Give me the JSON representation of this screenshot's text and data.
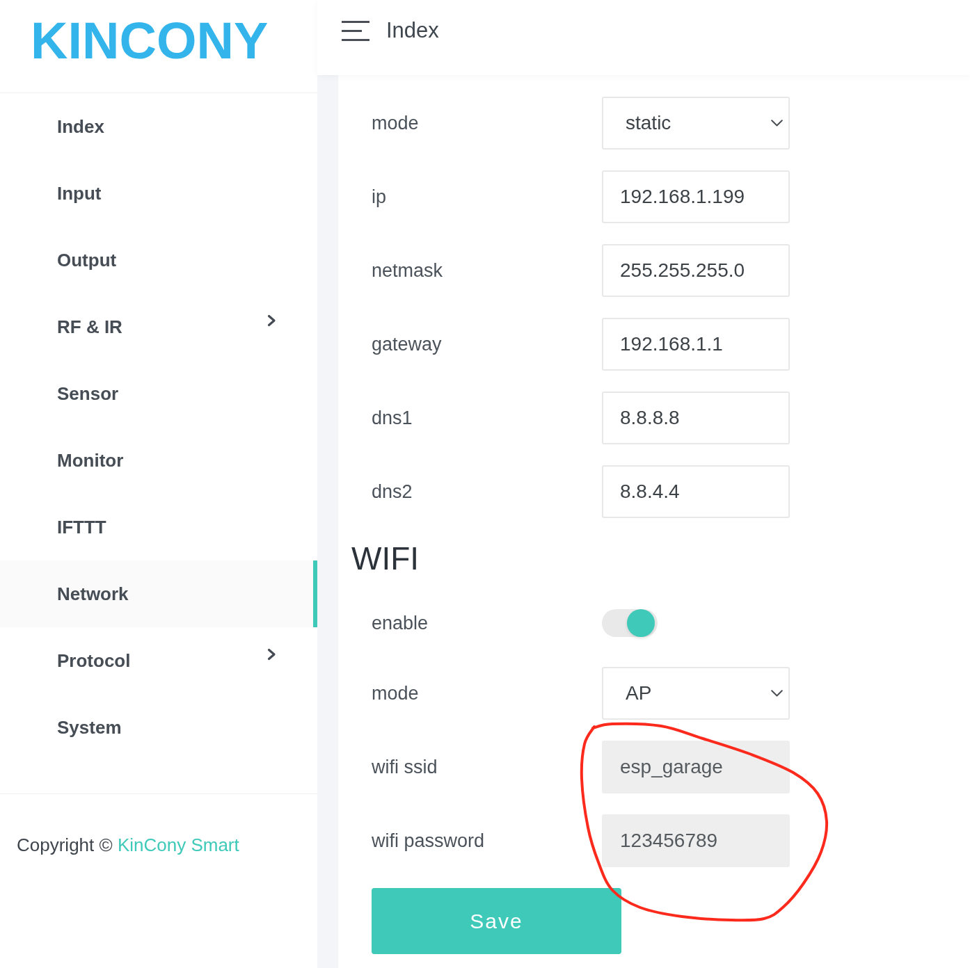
{
  "logo": {
    "text": "KINCONY"
  },
  "sidebar": {
    "items": [
      {
        "label": "Index",
        "selected": false,
        "expandable": false
      },
      {
        "label": "Input",
        "selected": false,
        "expandable": false
      },
      {
        "label": "Output",
        "selected": false,
        "expandable": false
      },
      {
        "label": "RF & IR",
        "selected": false,
        "expandable": true
      },
      {
        "label": "Sensor",
        "selected": false,
        "expandable": false
      },
      {
        "label": "Monitor",
        "selected": false,
        "expandable": false
      },
      {
        "label": "IFTTT",
        "selected": false,
        "expandable": false
      },
      {
        "label": "Network",
        "selected": true,
        "expandable": false
      },
      {
        "label": "Protocol",
        "selected": false,
        "expandable": true
      },
      {
        "label": "System",
        "selected": false,
        "expandable": false
      }
    ],
    "footer": {
      "text": "Copyright ©",
      "link": "KinCony Smart"
    }
  },
  "header": {
    "title": "Index"
  },
  "sections": [
    {
      "fields": [
        {
          "kind": "select",
          "label": "mode",
          "value": "static",
          "disabled": false
        },
        {
          "kind": "text",
          "label": "ip",
          "value": "192.168.1.199",
          "disabled": false
        },
        {
          "kind": "text",
          "label": "netmask",
          "value": "255.255.255.0",
          "disabled": false
        },
        {
          "kind": "text",
          "label": "gateway",
          "value": "192.168.1.1",
          "disabled": false
        },
        {
          "kind": "text",
          "label": "dns1",
          "value": "8.8.8.8",
          "disabled": false
        },
        {
          "kind": "text",
          "label": "dns2",
          "value": "8.8.4.4",
          "disabled": false
        }
      ]
    },
    {
      "title": "WIFI",
      "fields": [
        {
          "kind": "toggle",
          "label": "enable",
          "on": true,
          "disabled": false
        },
        {
          "kind": "select",
          "label": "mode",
          "value": "AP",
          "disabled": false
        },
        {
          "kind": "text",
          "label": "wifi ssid",
          "value": "esp_garage",
          "disabled": true
        },
        {
          "kind": "text",
          "label": "wifi password",
          "value": "123456789",
          "disabled": true
        }
      ]
    }
  ],
  "save_button": {
    "label": "Save"
  }
}
